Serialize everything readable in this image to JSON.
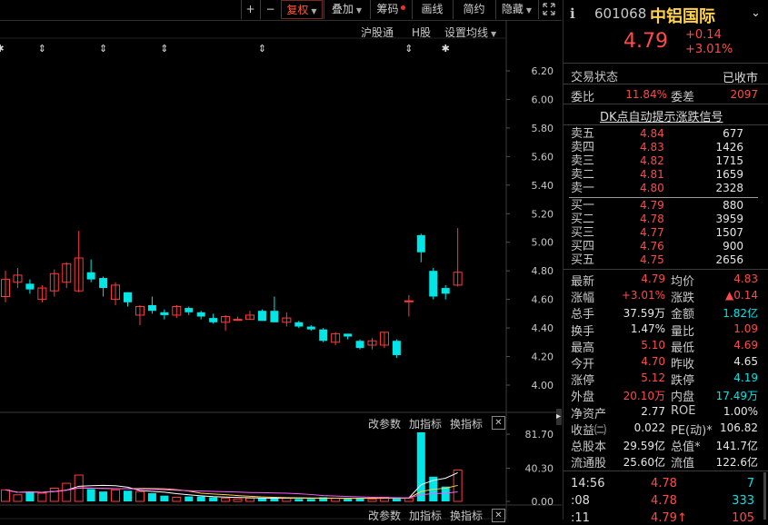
{
  "toolbar": {
    "plus": "+",
    "minus": "−",
    "fuquan": "复权",
    "diejia": "叠加",
    "chouma": "筹码",
    "huaxian": "画线",
    "jianyue": "简约",
    "yincang": "隐藏",
    "expand_icon": "expand-arrows-icon"
  },
  "main_chart": {
    "links": [
      "沪股通",
      "H股",
      "设置均线"
    ],
    "y_ticks": [
      "6.20",
      "6.00",
      "5.80",
      "5.60",
      "5.40",
      "5.20",
      "5.00",
      "4.80",
      "4.60",
      "4.40",
      "4.20",
      "4.00"
    ],
    "event_markers": [
      "⇕",
      "⇕",
      "⇕",
      "⇕",
      "⇕",
      "✱",
      "✱"
    ]
  },
  "volume_pane": {
    "links": [
      "改参数",
      "加指标",
      "换指标"
    ],
    "close": "✕",
    "y_ticks": [
      "81.70",
      "40.30",
      "0.00"
    ]
  },
  "bottom_pane": {
    "links": [
      "改参数",
      "加指标",
      "换指标"
    ],
    "close": "✕"
  },
  "header": {
    "code": "601068",
    "name": "中铝国际",
    "price": "4.79",
    "change": "+0.14",
    "change_pct": "+3.01%"
  },
  "status": {
    "label": "交易状态",
    "value": "已收市"
  },
  "weibi": {
    "label": "委比",
    "value": "11.84%",
    "label2": "委差",
    "value2": "2097"
  },
  "dk_signal": "DK点自动提示涨跌信号",
  "orderbook": {
    "asks": [
      {
        "label": "卖五",
        "price": "4.84",
        "vol": "677"
      },
      {
        "label": "卖四",
        "price": "4.83",
        "vol": "1426"
      },
      {
        "label": "卖三",
        "price": "4.82",
        "vol": "1715"
      },
      {
        "label": "卖二",
        "price": "4.81",
        "vol": "1659"
      },
      {
        "label": "卖一",
        "price": "4.80",
        "vol": "2328"
      }
    ],
    "bids": [
      {
        "label": "买一",
        "price": "4.79",
        "vol": "880"
      },
      {
        "label": "买二",
        "price": "4.78",
        "vol": "3959"
      },
      {
        "label": "买三",
        "price": "4.77",
        "vol": "1507"
      },
      {
        "label": "买四",
        "price": "4.76",
        "vol": "900"
      },
      {
        "label": "买五",
        "price": "4.75",
        "vol": "2656"
      }
    ]
  },
  "stats": [
    {
      "l1": "最新",
      "v1": "4.79",
      "c1": "red",
      "l2": "均价",
      "v2": "4.83",
      "c2": "red"
    },
    {
      "l1": "涨幅",
      "v1": "+3.01%",
      "c1": "red",
      "l2": "涨跌",
      "v2": "▲0.14",
      "c2": "red"
    },
    {
      "l1": "总手",
      "v1": "37.59万",
      "c1": "white",
      "l2": "金额",
      "v2": "1.82亿",
      "c2": "green"
    },
    {
      "l1": "换手",
      "v1": "1.47%",
      "c1": "white",
      "l2": "量比",
      "v2": "1.09",
      "c2": "red"
    },
    {
      "l1": "最高",
      "v1": "5.10",
      "c1": "red",
      "l2": "最低",
      "v2": "4.69",
      "c2": "red"
    },
    {
      "l1": "今开",
      "v1": "4.70",
      "c1": "red",
      "l2": "昨收",
      "v2": "4.65",
      "c2": "white"
    },
    {
      "l1": "涨停",
      "v1": "5.12",
      "c1": "red",
      "l2": "跌停",
      "v2": "4.19",
      "c2": "green"
    },
    {
      "l1": "外盘",
      "v1": "20.10万",
      "c1": "red",
      "l2": "内盘",
      "v2": "17.49万",
      "c2": "green"
    },
    {
      "l1": "净资产",
      "v1": "2.77",
      "c1": "white",
      "l2": "ROE",
      "v2": "1.00%",
      "c2": "white"
    },
    {
      "l1": "收益㈡",
      "v1": "0.022",
      "c1": "white",
      "l2": "PE(动)*",
      "v2": "106.82",
      "c2": "white"
    },
    {
      "l1": "总股本",
      "v1": "29.59亿",
      "c1": "white",
      "l2": "总值*",
      "v2": "141.7亿",
      "c2": "white"
    },
    {
      "l1": "流通股",
      "v1": "25.60亿",
      "c1": "white",
      "l2": "流值",
      "v2": "122.6亿",
      "c2": "white"
    }
  ],
  "ticks": [
    {
      "time": "14:56",
      "price": "4.78",
      "vol": "7",
      "vcolor": "green"
    },
    {
      "time": ":08",
      "price": "4.78",
      "vol": "333",
      "vcolor": "green"
    },
    {
      "time": ":11",
      "price": "4.79↑",
      "vol": "105",
      "vcolor": "red"
    }
  ],
  "chart_data": {
    "type": "candlestick",
    "price_range": [
      3.85,
      6.25
    ],
    "volume_range": [
      0,
      86
    ],
    "candles": [
      {
        "o": 4.62,
        "c": 4.74,
        "h": 4.8,
        "l": 4.58,
        "v": 14,
        "up": true
      },
      {
        "o": 4.72,
        "c": 4.77,
        "h": 4.82,
        "l": 4.68,
        "v": 8,
        "up": true
      },
      {
        "o": 4.71,
        "c": 4.67,
        "h": 4.74,
        "l": 4.64,
        "v": 12,
        "up": false
      },
      {
        "o": 4.6,
        "c": 4.68,
        "h": 4.7,
        "l": 4.58,
        "v": 10,
        "up": true
      },
      {
        "o": 4.66,
        "c": 4.78,
        "h": 4.81,
        "l": 4.62,
        "v": 16,
        "up": true
      },
      {
        "o": 4.72,
        "c": 4.85,
        "h": 4.86,
        "l": 4.68,
        "v": 22,
        "up": true
      },
      {
        "o": 4.66,
        "c": 4.89,
        "h": 5.08,
        "l": 4.65,
        "v": 32,
        "up": true
      },
      {
        "o": 4.79,
        "c": 4.74,
        "h": 4.88,
        "l": 4.72,
        "v": 15,
        "up": false
      },
      {
        "o": 4.75,
        "c": 4.68,
        "h": 4.76,
        "l": 4.62,
        "v": 12,
        "up": false
      },
      {
        "o": 4.6,
        "c": 4.7,
        "h": 4.72,
        "l": 4.56,
        "v": 14,
        "up": true
      },
      {
        "o": 4.65,
        "c": 4.58,
        "h": 4.65,
        "l": 4.55,
        "v": 13,
        "up": false
      },
      {
        "o": 4.49,
        "c": 4.55,
        "h": 4.56,
        "l": 4.42,
        "v": 12,
        "up": true
      },
      {
        "o": 4.56,
        "c": 4.52,
        "h": 4.62,
        "l": 4.5,
        "v": 10,
        "up": false
      },
      {
        "o": 4.51,
        "c": 4.49,
        "h": 4.53,
        "l": 4.46,
        "v": 7,
        "up": false
      },
      {
        "o": 4.49,
        "c": 4.55,
        "h": 4.56,
        "l": 4.47,
        "v": 5,
        "up": true
      },
      {
        "o": 4.54,
        "c": 4.51,
        "h": 4.55,
        "l": 4.49,
        "v": 6,
        "up": false
      },
      {
        "o": 4.51,
        "c": 4.48,
        "h": 4.52,
        "l": 4.46,
        "v": 6,
        "up": false
      },
      {
        "o": 4.47,
        "c": 4.44,
        "h": 4.5,
        "l": 4.43,
        "v": 5,
        "up": false
      },
      {
        "o": 4.44,
        "c": 4.48,
        "h": 4.49,
        "l": 4.38,
        "v": 4,
        "up": true
      },
      {
        "o": 4.46,
        "c": 4.46,
        "h": 4.48,
        "l": 4.45,
        "v": 3,
        "up": true
      },
      {
        "o": 4.46,
        "c": 4.49,
        "h": 4.52,
        "l": 4.46,
        "v": 4,
        "up": true
      },
      {
        "o": 4.52,
        "c": 4.45,
        "h": 4.53,
        "l": 4.45,
        "v": 4,
        "up": false
      },
      {
        "o": 4.52,
        "c": 4.44,
        "h": 4.62,
        "l": 4.44,
        "v": 5,
        "up": false
      },
      {
        "o": 4.44,
        "c": 4.47,
        "h": 4.51,
        "l": 4.41,
        "v": 4,
        "up": true
      },
      {
        "o": 4.44,
        "c": 4.41,
        "h": 4.45,
        "l": 4.4,
        "v": 3,
        "up": false
      },
      {
        "o": 4.41,
        "c": 4.39,
        "h": 4.42,
        "l": 4.38,
        "v": 3,
        "up": false
      },
      {
        "o": 4.39,
        "c": 4.31,
        "h": 4.4,
        "l": 4.3,
        "v": 5,
        "up": false
      },
      {
        "o": 4.3,
        "c": 4.36,
        "h": 4.37,
        "l": 4.28,
        "v": 4,
        "up": true
      },
      {
        "o": 4.36,
        "c": 4.34,
        "h": 4.36,
        "l": 4.32,
        "v": 3,
        "up": false
      },
      {
        "o": 4.31,
        "c": 4.26,
        "h": 4.32,
        "l": 4.25,
        "v": 4,
        "up": false
      },
      {
        "o": 4.28,
        "c": 4.31,
        "h": 4.33,
        "l": 4.25,
        "v": 3,
        "up": true
      },
      {
        "o": 4.28,
        "c": 4.37,
        "h": 4.37,
        "l": 4.26,
        "v": 5,
        "up": true
      },
      {
        "o": 4.31,
        "c": 4.21,
        "h": 4.32,
        "l": 4.19,
        "v": 5,
        "up": false
      },
      {
        "o": 4.59,
        "c": 4.59,
        "h": 4.63,
        "l": 4.48,
        "v": 4,
        "up": true
      },
      {
        "o": 5.05,
        "c": 4.93,
        "h": 5.06,
        "l": 4.86,
        "v": 84,
        "up": false
      },
      {
        "o": 4.8,
        "c": 4.62,
        "h": 4.82,
        "l": 4.6,
        "v": 30,
        "up": false
      },
      {
        "o": 4.68,
        "c": 4.64,
        "h": 4.7,
        "l": 4.6,
        "v": 18,
        "up": false
      },
      {
        "o": 4.7,
        "c": 4.79,
        "h": 5.1,
        "l": 4.69,
        "v": 38,
        "up": true
      }
    ]
  }
}
